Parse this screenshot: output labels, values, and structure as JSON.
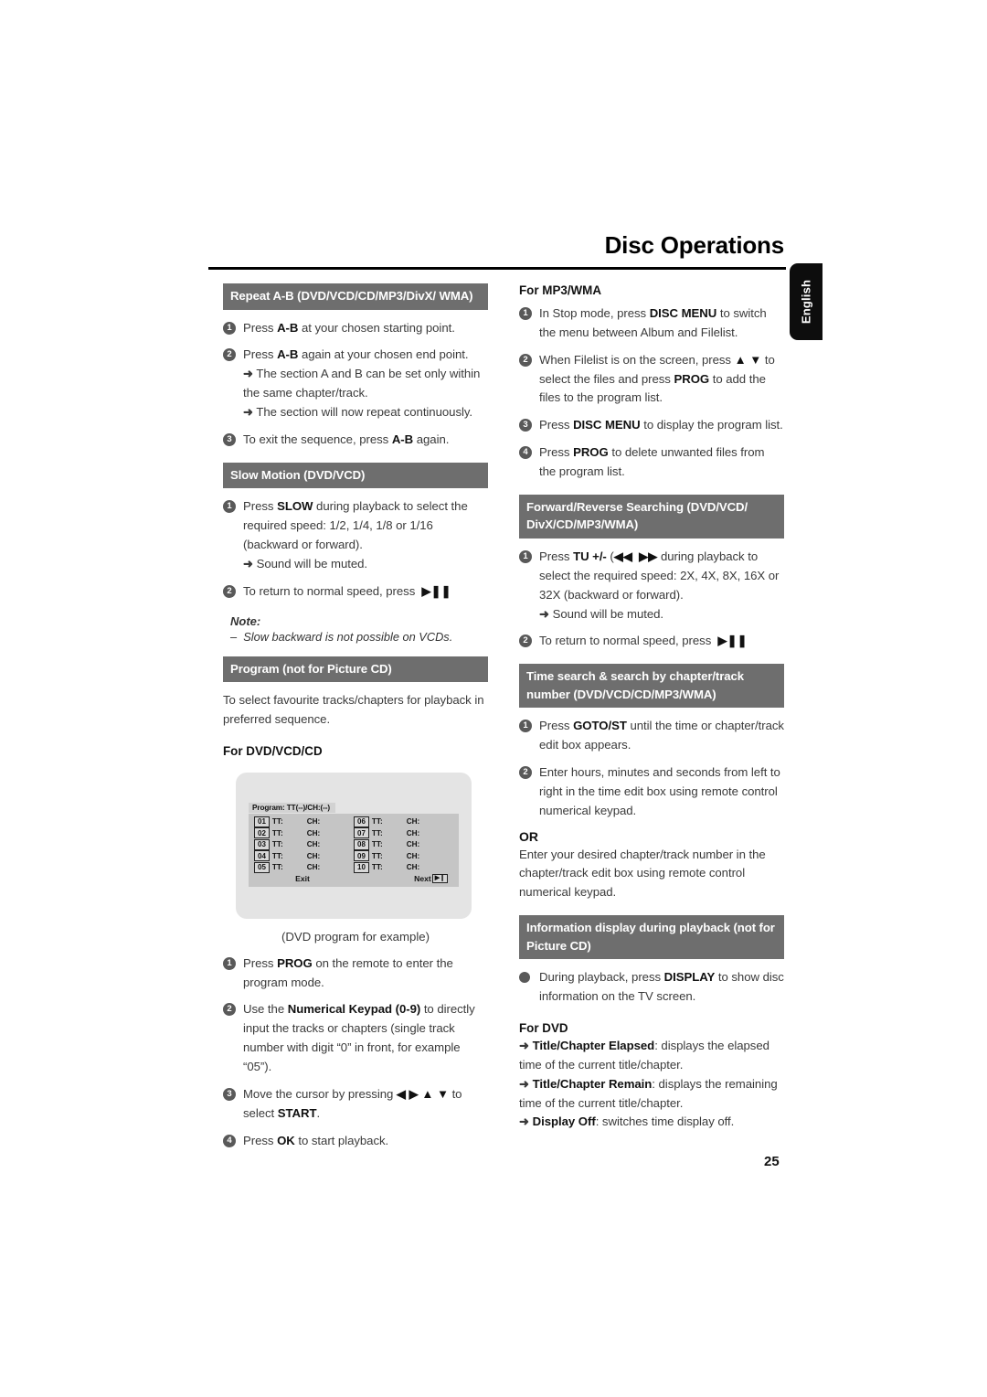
{
  "document": {
    "title": "Disc Operations",
    "language_tab": "English",
    "page_number": "25"
  },
  "left_column": {
    "sections": [
      {
        "id": "repeat-ab",
        "header": "Repeat A-B (DVD/VCD/CD/MP3/DivX/ WMA)",
        "steps": [
          {
            "num": "1",
            "text": "Press A-B at your chosen starting point.",
            "bold": [
              "A-B"
            ]
          },
          {
            "num": "2",
            "text": "Press A-B again at your chosen end point.",
            "bold": [
              "A-B"
            ],
            "arrows": [
              "The section A and B can be set only within the same chapter/track.",
              "The section will now repeat continuously."
            ]
          },
          {
            "num": "3",
            "text": "To exit the sequence, press A-B again.",
            "bold": [
              "A-B"
            ]
          }
        ]
      },
      {
        "id": "slow-motion",
        "header": "Slow Motion (DVD/VCD)",
        "steps": [
          {
            "num": "1",
            "text": "Press SLOW during playback to select the required speed: 1/2, 1/4, 1/8 or 1/16 (backward or forward).",
            "bold": [
              "SLOW"
            ],
            "arrows": [
              "Sound will be muted."
            ]
          },
          {
            "num": "2",
            "text": "To return to normal speed, press ▶❙❙",
            "bold": []
          }
        ],
        "note_title": "Note:",
        "note_items": [
          "Slow backward is not possible on VCDs."
        ]
      },
      {
        "id": "program",
        "header": "Program (not for Picture CD)",
        "intro": "To select favourite tracks/chapters for playback in preferred sequence.",
        "subhead": "For DVD/VCD/CD",
        "figure": {
          "title": "Program: TT(--)/CH:(--)",
          "rows": [
            {
              "left_num": "01",
              "left_tt": "TT:",
              "left_ch": "CH:",
              "right_num": "06",
              "right_tt": "TT:",
              "right_ch": "CH:"
            },
            {
              "left_num": "02",
              "left_tt": "TT:",
              "left_ch": "CH:",
              "right_num": "07",
              "right_tt": "TT:",
              "right_ch": "CH:"
            },
            {
              "left_num": "03",
              "left_tt": "TT:",
              "left_ch": "CH:",
              "right_num": "08",
              "right_tt": "TT:",
              "right_ch": "CH:"
            },
            {
              "left_num": "04",
              "left_tt": "TT:",
              "left_ch": "CH:",
              "right_num": "09",
              "right_tt": "TT:",
              "right_ch": "CH:"
            },
            {
              "left_num": "05",
              "left_tt": "TT:",
              "left_ch": "CH:",
              "right_num": "10",
              "right_tt": "TT:",
              "right_ch": "CH:"
            }
          ],
          "exit_label": "Exit",
          "next_label": "Next",
          "next_icon": "▶❙"
        },
        "caption": "(DVD program for example)",
        "steps": [
          {
            "num": "1",
            "text": "Press PROG on the remote to enter the program mode.",
            "bold": [
              "PROG"
            ]
          },
          {
            "num": "2",
            "text": "Use the Numerical Keypad (0-9) to directly input the tracks or chapters (single track number with digit “0” in front, for example “05”).",
            "bold": [
              "Numerical Keypad (0-9)"
            ]
          },
          {
            "num": "3",
            "text": "Move the cursor by pressing ◀ ▶ ▲ ▼ to select START.",
            "bold": [
              "START"
            ]
          },
          {
            "num": "4",
            "text": "Press OK to start playback.",
            "bold": [
              "OK"
            ]
          }
        ]
      }
    ]
  },
  "right_column": {
    "sections": [
      {
        "id": "for-mp3-wma",
        "subhead": "For MP3/WMA",
        "steps": [
          {
            "num": "1",
            "text": "In Stop mode, press DISC MENU to switch the menu between Album and Filelist.",
            "bold": [
              "DISC MENU"
            ]
          },
          {
            "num": "2",
            "text": "When Filelist is on the screen, press ▲ ▼ to select the files and press PROG to add the files to the program list.",
            "bold": [
              "PROG"
            ]
          },
          {
            "num": "3",
            "text": "Press DISC MENU to display the program list.",
            "bold": [
              "DISC MENU"
            ]
          },
          {
            "num": "4",
            "text": "Press PROG to delete unwanted files from the program list.",
            "bold": [
              "PROG"
            ]
          }
        ]
      },
      {
        "id": "fwd-rev-search",
        "header": "Forward/Reverse Searching (DVD/VCD/ DivX/CD/MP3/WMA)",
        "steps": [
          {
            "num": "1",
            "text": "Press TU +/- (◀◀  ▶▶ during playback to select the required speed: 2X, 4X, 8X, 16X or 32X (backward or forward).",
            "bold": [
              "TU +/-"
            ],
            "arrows": [
              "Sound will be muted."
            ]
          },
          {
            "num": "2",
            "text": "To return to normal speed, press ▶❙❙",
            "bold": []
          }
        ]
      },
      {
        "id": "time-search",
        "header": "Time search & search by chapter/track number (DVD/VCD/CD/MP3/WMA)",
        "steps": [
          {
            "num": "1",
            "text": "Press GOTO/ST until the time or chapter/track edit box appears.",
            "bold": [
              "GOTO/ST"
            ]
          },
          {
            "num": "2",
            "text": "Enter hours, minutes and seconds from left to right in the time edit box using remote control numerical keypad.",
            "bold": []
          }
        ],
        "or_word": "OR",
        "or_text": "Enter your desired chapter/track number in the chapter/track edit box using remote control numerical keypad."
      },
      {
        "id": "info-display",
        "header": "Information display during playback (not for Picture CD)",
        "bullet_text": "During playback, press DISPLAY to show disc information on the TV screen.",
        "subhead": "For DVD",
        "arrow_items": [
          {
            "label": "Title/Chapter Elapsed",
            "text": ": displays the elapsed time of the current title/chapter."
          },
          {
            "label": "Title/Chapter Remain",
            "text": ": displays the remaining time of the current title/chapter."
          },
          {
            "label": "Display Off",
            "text": ": switches time display off."
          }
        ]
      }
    ]
  }
}
